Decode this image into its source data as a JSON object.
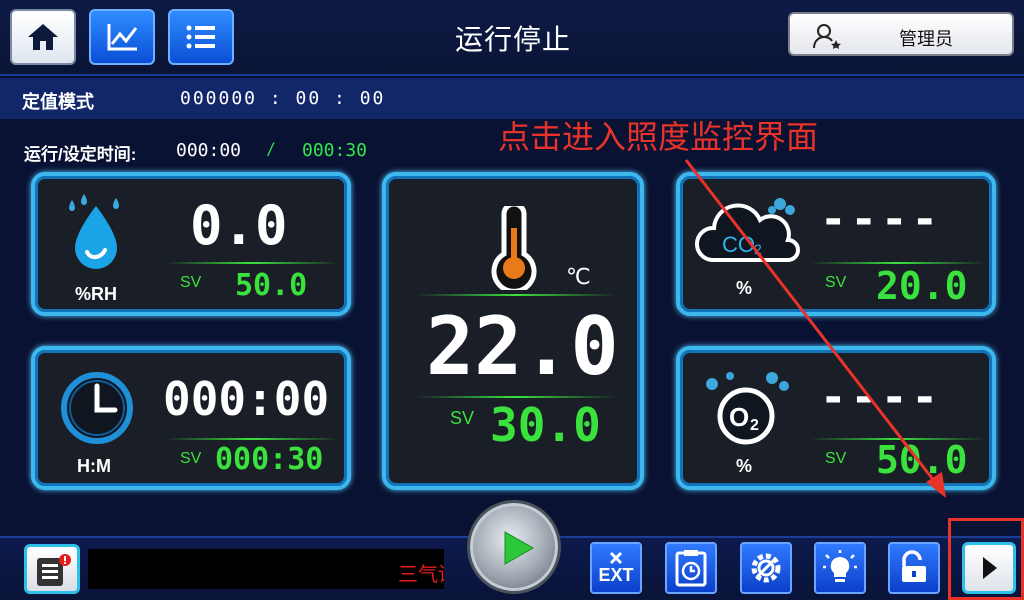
{
  "header": {
    "title": "运行停止",
    "user_label": "管理员",
    "icons": [
      "home-icon",
      "chart-icon",
      "list-icon",
      "user-icon"
    ]
  },
  "mode": {
    "label": "定值模式",
    "time": "000000 : 00 : 00"
  },
  "run": {
    "label": "运行/设定时间:",
    "elapsed": "000:00",
    "separator": "/",
    "set": "000:30"
  },
  "annotation": "点击进入照度监控界面",
  "humidity": {
    "pv": "0.0",
    "sv_label": "SV",
    "sv": "50.0",
    "unit": "%RH"
  },
  "time_panel": {
    "pv": "000:00",
    "sv_label": "SV",
    "sv": "000:30",
    "unit": "H:M"
  },
  "temperature": {
    "pv": "22.0",
    "sv_label": "SV",
    "sv": "30.0",
    "unit": "℃"
  },
  "co2": {
    "pv": "----",
    "sv_label": "SV",
    "sv": "20.0",
    "unit": "%",
    "icon_text": "CO",
    "icon_sub": "2"
  },
  "o2": {
    "pv": "----",
    "sv_label": "SV",
    "sv": "50.0",
    "unit": "%",
    "icon_text": "O",
    "icon_sub": "2"
  },
  "bottom": {
    "ticker_text": "三气调",
    "exit_label": "EXT",
    "tools": [
      "exit-icon",
      "clipboard-timer-icon",
      "gear-icon",
      "light-bulb-icon",
      "unlock-icon"
    ]
  },
  "colors": {
    "accent_blue": "#3db8ee",
    "sv_green": "#39e23d",
    "annotation_red": "#e8332a"
  }
}
